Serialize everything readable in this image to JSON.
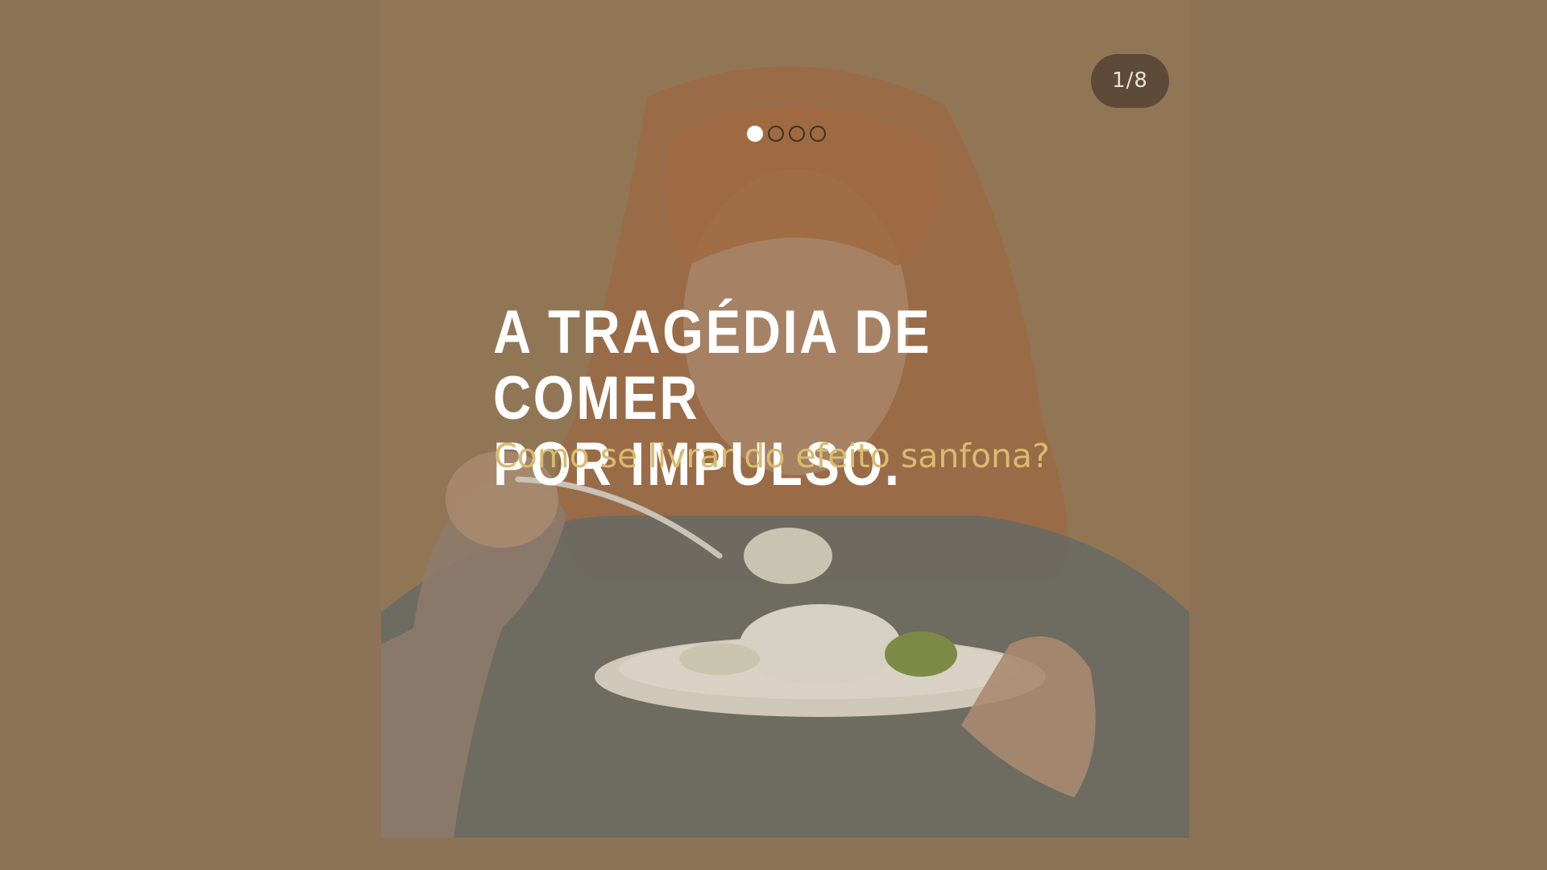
{
  "slide": {
    "counter": "1/8",
    "headline": "A TRAGÉDIA DE COMER\nPOR IMPULSO.",
    "subheadline": "Como se livrar do efeito sanfona?",
    "pagination": {
      "total_dots": 4,
      "active_index": 0
    }
  },
  "colors": {
    "background": "#8c7357",
    "headline": "#ffffff",
    "subheadline": "#d9bb6e",
    "counter_bg": "#4e3e30",
    "counter_text": "#e9e1d6"
  },
  "image": {
    "subject": "woman-eating-salad-photo"
  }
}
